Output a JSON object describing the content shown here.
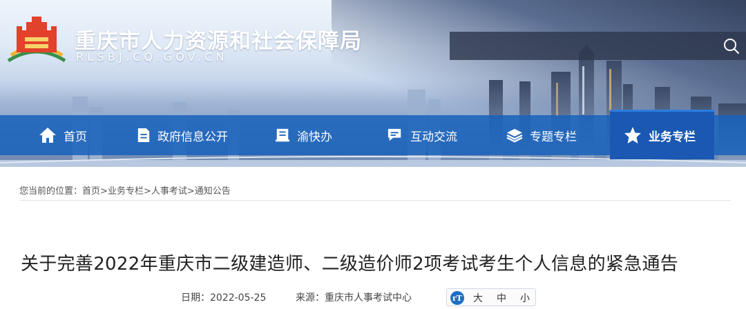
{
  "header": {
    "title": "重庆市人力资源和社会保障局",
    "domain": "RLSBJ.CQ.GOV.CN",
    "logo_icon": "city-gate-logo-icon",
    "search_icon": "search-icon"
  },
  "nav": {
    "items": [
      {
        "label": "首页",
        "icon": "home-icon"
      },
      {
        "label": "政府信息公开",
        "icon": "document-icon"
      },
      {
        "label": "渝快办",
        "icon": "book-icon"
      },
      {
        "label": "互动交流",
        "icon": "chat-icon"
      },
      {
        "label": "专题专栏",
        "icon": "layers-icon"
      },
      {
        "label": "业务专栏",
        "icon": "star-icon"
      }
    ],
    "active_index": 5,
    "colors": {
      "bar": "#1762bc",
      "active": "#1a58b3"
    }
  },
  "breadcrumb": {
    "prefix": "您当前的位置：",
    "items": [
      "首页",
      "业务专栏",
      "人事考试",
      "通知公告"
    ],
    "separator": ">"
  },
  "article": {
    "title": "关于完善2022年重庆市二级建造师、二级造价师2项考试考生个人信息的紧急通告",
    "date": "日期：2022-05-25",
    "source": "来源：重庆市人事考试中心",
    "font_switch": {
      "icon_label": "rT",
      "large": "大",
      "medium": "中",
      "small": "小"
    }
  }
}
